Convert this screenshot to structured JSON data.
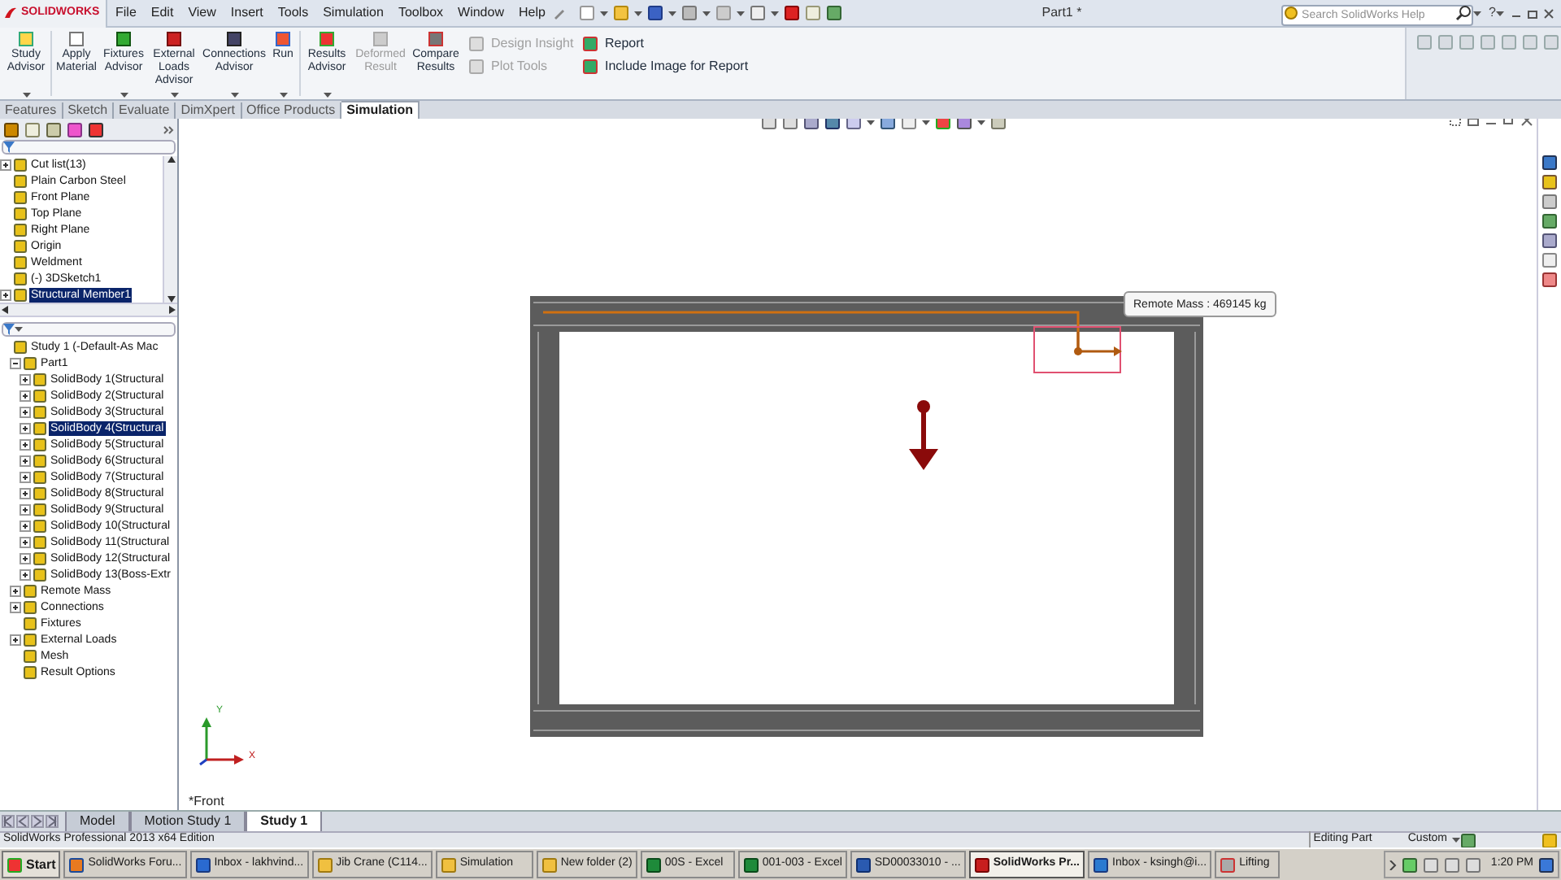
{
  "app_logo": "SOLIDWORKS",
  "menu": [
    "File",
    "Edit",
    "View",
    "Insert",
    "Tools",
    "Simulation",
    "Toolbox",
    "Window",
    "Help"
  ],
  "document_title": "Part1 *",
  "help_search": {
    "placeholder": "Search SolidWorks Help"
  },
  "help_button": "?",
  "command_buttons": [
    {
      "label": "Study Advisor",
      "disabled": false,
      "dropdown": true
    },
    {
      "label": "Apply Material",
      "disabled": false,
      "dropdown": false
    },
    {
      "label": "Fixtures Advisor",
      "disabled": false,
      "dropdown": true
    },
    {
      "label": "External Loads Advisor",
      "disabled": false,
      "dropdown": true
    },
    {
      "label": "Connections Advisor",
      "disabled": false,
      "dropdown": true
    },
    {
      "label": "Run",
      "disabled": false,
      "dropdown": true
    },
    {
      "label": "Results Advisor",
      "disabled": false,
      "dropdown": true
    },
    {
      "label": "Deformed Result",
      "disabled": true,
      "dropdown": false
    },
    {
      "label": "Compare Results",
      "disabled": false,
      "dropdown": false
    }
  ],
  "command_list": [
    {
      "label": "Design Insight",
      "disabled": true
    },
    {
      "label": "Plot Tools",
      "disabled": true
    },
    {
      "label": "Report",
      "disabled": false
    },
    {
      "label": "Include Image for Report",
      "disabled": false
    }
  ],
  "tabs": [
    {
      "label": "Features",
      "selected": false
    },
    {
      "label": "Sketch",
      "selected": false
    },
    {
      "label": "Evaluate",
      "selected": false
    },
    {
      "label": "DimXpert",
      "selected": false
    },
    {
      "label": "Office Products",
      "selected": false
    },
    {
      "label": "Simulation",
      "selected": true
    }
  ],
  "feature_tree": [
    {
      "label": "Cut list(13)",
      "expanded": false,
      "selected": false
    },
    {
      "label": "Plain Carbon Steel",
      "selected": false
    },
    {
      "label": "Front Plane",
      "selected": false
    },
    {
      "label": "Top Plane",
      "selected": false
    },
    {
      "label": "Right Plane",
      "selected": false
    },
    {
      "label": "Origin",
      "selected": false
    },
    {
      "label": "Weldment",
      "selected": false
    },
    {
      "label": "(-) 3DSketch1",
      "selected": false
    },
    {
      "label": "Structural Member1",
      "expanded": false,
      "selected": true
    }
  ],
  "simulation_tree": [
    {
      "label": "Study 1 (-Default-As Mac",
      "selected": false,
      "children": [
        {
          "label": "Part1",
          "expanded": true,
          "selected": false,
          "children": [
            {
              "label": "SolidBody 1(Structural",
              "expanded": false,
              "selected": false
            },
            {
              "label": "SolidBody 2(Structural",
              "expanded": false,
              "selected": false
            },
            {
              "label": "SolidBody 3(Structural",
              "expanded": false,
              "selected": false
            },
            {
              "label": "SolidBody 4(Structural",
              "expanded": false,
              "selected": true
            },
            {
              "label": "SolidBody 5(Structural",
              "expanded": false,
              "selected": false
            },
            {
              "label": "SolidBody 6(Structural",
              "expanded": false,
              "selected": false
            },
            {
              "label": "SolidBody 7(Structural",
              "expanded": false,
              "selected": false
            },
            {
              "label": "SolidBody 8(Structural",
              "expanded": false,
              "selected": false
            },
            {
              "label": "SolidBody 9(Structural",
              "expanded": false,
              "selected": false
            },
            {
              "label": "SolidBody 10(Structural",
              "expanded": false,
              "selected": false
            },
            {
              "label": "SolidBody 11(Structural",
              "expanded": false,
              "selected": false
            },
            {
              "label": "SolidBody 12(Structural",
              "expanded": false,
              "selected": false
            },
            {
              "label": "SolidBody 13(Boss-Extr",
              "expanded": false,
              "selected": false
            }
          ]
        },
        {
          "label": "Remote Mass",
          "expanded": false,
          "selected": false
        },
        {
          "label": "Connections",
          "expanded": false,
          "selected": false
        },
        {
          "label": "Fixtures",
          "selected": false
        },
        {
          "label": "External Loads",
          "expanded": false,
          "selected": false
        },
        {
          "label": "Mesh",
          "selected": false
        },
        {
          "label": "Result Options",
          "selected": false
        }
      ]
    }
  ],
  "viewport": {
    "callout": "Remote Mass : 469145 kg",
    "view_label": "*Front",
    "triad_labels": [
      "Y",
      "X"
    ]
  },
  "bottom_tabs": [
    {
      "label": "Model",
      "selected": false
    },
    {
      "label": "Motion Study 1",
      "selected": false
    },
    {
      "label": "Study 1",
      "selected": true
    }
  ],
  "status_bar": {
    "product": "SolidWorks Professional 2013 x64 Edition",
    "mode": "Editing Part",
    "units": "Custom"
  },
  "taskbar": {
    "start": "Start",
    "clock": "1:20 PM",
    "items": [
      {
        "label": "SolidWorks Foru...",
        "selected": false
      },
      {
        "label": "Inbox - lakhvind...",
        "selected": false
      },
      {
        "label": "Jib Crane (C114...",
        "selected": false
      },
      {
        "label": "Simulation",
        "selected": false
      },
      {
        "label": "New folder (2)",
        "selected": false
      },
      {
        "label": "00S - Excel",
        "selected": false
      },
      {
        "label": "001-003 - Excel",
        "selected": false
      },
      {
        "label": "SD00033010 - ...",
        "selected": false
      },
      {
        "label": "SolidWorks Pr...",
        "selected": true
      },
      {
        "label": "Inbox - ksingh@i...",
        "selected": false
      },
      {
        "label": "Lifting",
        "selected": false
      }
    ]
  }
}
